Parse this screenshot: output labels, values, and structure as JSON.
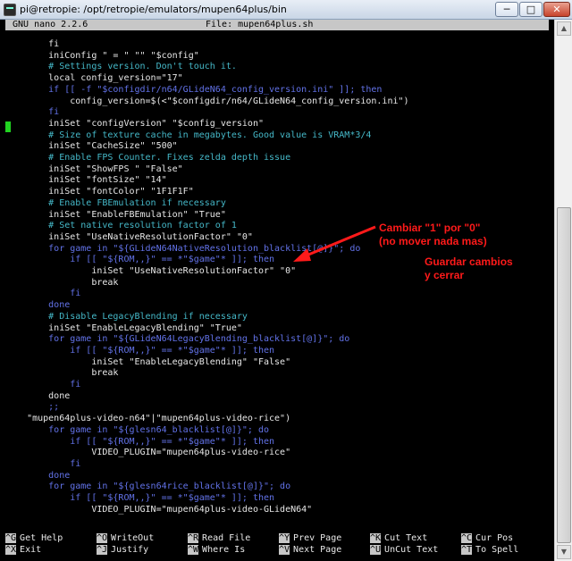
{
  "window": {
    "title": "pi@retropie: /opt/retropie/emulators/mupen64plus/bin",
    "minimize": "─",
    "maximize": "□",
    "close": "✕"
  },
  "nano": {
    "version": "GNU nano 2.2.6",
    "file": "File: mupen64plus.sh"
  },
  "code_lines": [
    {
      "text": "        fi",
      "color": "default"
    },
    {
      "text": "        iniConfig \" = \" \"\" \"$config\"",
      "color": "default"
    },
    {
      "text": "        # Settings version. Don't touch it.",
      "color": "cyan"
    },
    {
      "text": "        local config_version=\"17\"",
      "color": "default"
    },
    {
      "text": "        if [[ -f \"$configdir/n64/GLideN64_config_version.ini\" ]]; then",
      "color": "blue"
    },
    {
      "text": "            config_version=$(<\"$configdir/n64/GLideN64_config_version.ini\")",
      "color": "default"
    },
    {
      "text": "        fi",
      "color": "blue"
    },
    {
      "text": "        iniSet \"configVersion\" \"$config_version\"",
      "color": "default"
    },
    {
      "text": "        # Size of texture cache in megabytes. Good value is VRAM*3/4",
      "color": "cyan"
    },
    {
      "text": "        iniSet \"CacheSize\" \"500\"",
      "color": "default"
    },
    {
      "text": "        # Enable FPS Counter. Fixes zelda depth issue",
      "color": "cyan"
    },
    {
      "text": "        iniSet \"ShowFPS \" \"False\"",
      "color": "default"
    },
    {
      "text": "        iniSet \"fontSize\" \"14\"",
      "color": "default"
    },
    {
      "text": "        iniSet \"fontColor\" \"1F1F1F\"",
      "color": "default"
    },
    {
      "text": "        # Enable FBEmulation if necessary",
      "color": "cyan"
    },
    {
      "text": "        iniSet \"EnableFBEmulation\" \"True\"",
      "color": "default"
    },
    {
      "text": "        # Set native resolution factor of 1",
      "color": "cyan"
    },
    {
      "text": "        iniSet \"UseNativeResolutionFactor\" \"0\"",
      "color": "default"
    },
    {
      "text": "        for game in \"${GLideN64NativeResolution_blacklist[@]}\"; do",
      "color": "blue"
    },
    {
      "text": "            if [[ \"${ROM,,}\" == *\"$game\"* ]]; then",
      "color": "blue"
    },
    {
      "text": "                iniSet \"UseNativeResolutionFactor\" \"0\"",
      "color": "default"
    },
    {
      "text": "                break",
      "color": "default"
    },
    {
      "text": "            fi",
      "color": "blue"
    },
    {
      "text": "        done",
      "color": "blue"
    },
    {
      "text": "        # Disable LegacyBlending if necessary",
      "color": "cyan"
    },
    {
      "text": "        iniSet \"EnableLegacyBlending\" \"True\"",
      "color": "default"
    },
    {
      "text": "        for game in \"${GLideN64LegacyBlending_blacklist[@]}\"; do",
      "color": "blue"
    },
    {
      "text": "            if [[ \"${ROM,,}\" == *\"$game\"* ]]; then",
      "color": "blue"
    },
    {
      "text": "                iniSet \"EnableLegacyBlending\" \"False\"",
      "color": "default"
    },
    {
      "text": "                break",
      "color": "default"
    },
    {
      "text": "            fi",
      "color": "blue"
    },
    {
      "text": "        done",
      "color": "default"
    },
    {
      "text": "        ;;",
      "color": "blue"
    },
    {
      "text": "    \"mupen64plus-video-n64\"|\"mupen64plus-video-rice\")",
      "color": "default"
    },
    {
      "text": "        for game in \"${glesn64_blacklist[@]}\"; do",
      "color": "blue"
    },
    {
      "text": "            if [[ \"${ROM,,}\" == *\"$game\"* ]]; then",
      "color": "blue"
    },
    {
      "text": "                VIDEO_PLUGIN=\"mupen64plus-video-rice\"",
      "color": "default"
    },
    {
      "text": "            fi",
      "color": "blue"
    },
    {
      "text": "        done",
      "color": "blue"
    },
    {
      "text": "        for game in \"${glesn64rice_blacklist[@]}\"; do",
      "color": "blue"
    },
    {
      "text": "            if [[ \"${ROM,,}\" == *\"$game\"* ]]; then",
      "color": "blue"
    },
    {
      "text": "                VIDEO_PLUGIN=\"mupen64plus-video-GLideN64\"",
      "color": "default"
    }
  ],
  "annotations": {
    "change_note": "Cambiar \"1\" por \"0\"\n(no mover nada mas)",
    "save_note": "Guardar cambios\ny cerrar"
  },
  "shortcuts": [
    {
      "key": "^G",
      "label": "Get Help"
    },
    {
      "key": "^O",
      "label": "WriteOut"
    },
    {
      "key": "^R",
      "label": "Read File"
    },
    {
      "key": "^Y",
      "label": "Prev Page"
    },
    {
      "key": "^K",
      "label": "Cut Text"
    },
    {
      "key": "^C",
      "label": "Cur Pos"
    },
    {
      "key": "^X",
      "label": "Exit"
    },
    {
      "key": "^J",
      "label": "Justify"
    },
    {
      "key": "^W",
      "label": "Where Is"
    },
    {
      "key": "^V",
      "label": "Next Page"
    },
    {
      "key": "^U",
      "label": "UnCut Text"
    },
    {
      "key": "^T",
      "label": "To Spell"
    }
  ],
  "colors": {
    "default": "#e8e8e8",
    "cyan": "#45b8c8",
    "blue": "#6272e8",
    "annotation": "#ff1a1a",
    "cursor": "#21d321"
  }
}
